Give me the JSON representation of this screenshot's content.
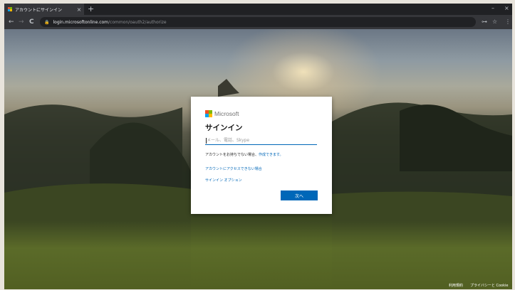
{
  "browser": {
    "tab_title": "アカウントにサインイン",
    "tab_close": "×",
    "new_tab": "+",
    "minimize": "–",
    "close_window": "×",
    "back": "←",
    "forward": "→",
    "reload": "C",
    "url_host": "login.microsoftonline.com",
    "url_path": "/common/oauth2/authorize",
    "menu": "⋮",
    "star": "☆",
    "key": "⊶"
  },
  "icons": {
    "favicon": "microsoft-logo-icon",
    "lock": "lock-icon"
  },
  "colors": {
    "ms_red": "#f25022",
    "ms_green": "#7fba00",
    "ms_blue": "#00a4ef",
    "ms_yellow": "#ffb900",
    "accent": "#0067b8"
  },
  "signin": {
    "brand": "Microsoft",
    "title": "サインイン",
    "input_placeholder": "メール、電話、Skype",
    "input_value": "",
    "no_account_text": "アカウントをお持ちでない場合、",
    "create_link": "作成できます。",
    "cant_access_link": "アカウントにアクセスできない場合",
    "signin_options_link": "サインイン オプション",
    "next_button": "次へ"
  },
  "footer": {
    "terms": "利用規約",
    "privacy": "プライバシーと Cookie"
  }
}
